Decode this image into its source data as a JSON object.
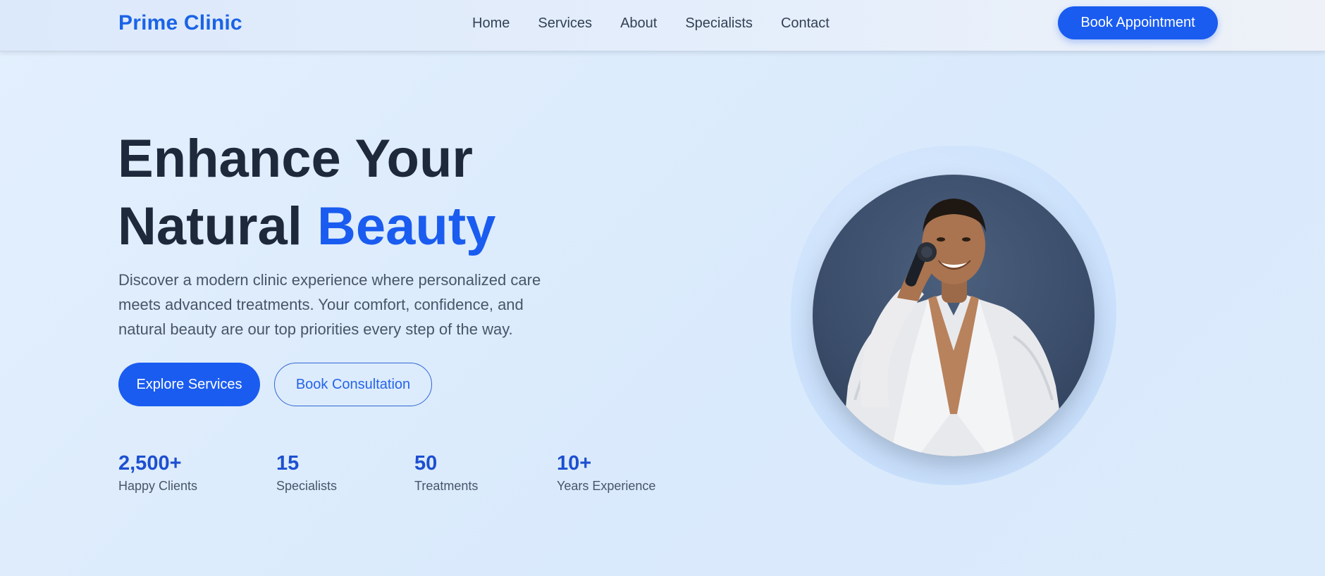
{
  "header": {
    "brand": "Prime Clinic",
    "nav": [
      "Home",
      "Services",
      "About",
      "Specialists",
      "Contact"
    ],
    "cta": "Book Appointment"
  },
  "hero": {
    "title_line1": "Enhance Your",
    "title_line2_plain": "Natural ",
    "title_line2_accent": "Beauty",
    "description": "Discover a modern clinic experience where personalized care meets advanced treatments. Your comfort, confidence, and natural beauty are our top priorities every step of the way.",
    "primary_button": "Explore Services",
    "secondary_button": "Book Consultation"
  },
  "stats": [
    {
      "value": "2,500+",
      "label": "Happy Clients"
    },
    {
      "value": "15",
      "label": "Specialists"
    },
    {
      "value": "50",
      "label": "Treatments"
    },
    {
      "value": "10+",
      "label": "Years Experience"
    }
  ],
  "colors": {
    "accent": "#1a5cf0",
    "heading": "#1e293b",
    "body_text": "#475569",
    "stat_number": "#1d4fd0"
  }
}
